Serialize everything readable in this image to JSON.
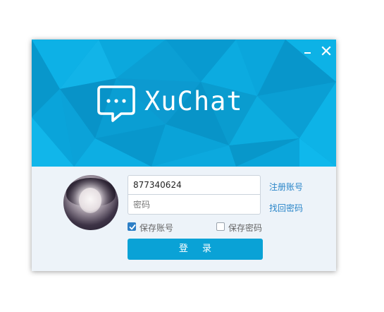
{
  "window": {
    "app_name": "XuChat",
    "minimize_label": "−",
    "close_label": "×",
    "accent_color": "#0aa2d6"
  },
  "form": {
    "account_value": "877340624",
    "password_placeholder": "密码",
    "register_link": "注册账号",
    "recover_link": "找回密码",
    "remember_account": {
      "label": "保存账号",
      "checked": true
    },
    "remember_password": {
      "label": "保存密码",
      "checked": false
    },
    "login_button": "登 录"
  },
  "icons": {
    "logo": "chat-bubble-icon",
    "minimize": "minimize-icon",
    "close": "close-icon",
    "avatar": "user-avatar"
  }
}
